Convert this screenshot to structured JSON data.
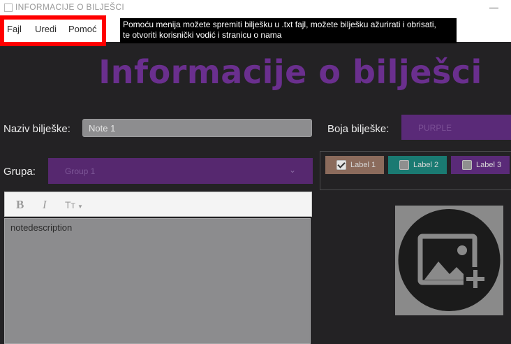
{
  "window": {
    "title": "INFORMACIJE O BILJEŠCI",
    "minimize_glyph": "—"
  },
  "menu": {
    "items": [
      "Fajl",
      "Uredi",
      "Pomoć"
    ]
  },
  "tooltip": {
    "line1": "Pomoću menija možete spremiti bilješku u .txt fajl, možete bilješku ažurirati i obrisati,",
    "line2": "te otvoriti korisnički vodić i stranicu o nama"
  },
  "heading": "Informacije o bilješci",
  "form": {
    "name_label": "Naziv bilješke:",
    "name_value": "Note 1",
    "color_label": "Boja bilješke:",
    "color_value": "PURPLE",
    "group_label": "Grupa:",
    "group_value": "Group 1"
  },
  "labels": [
    {
      "text": "Label 1",
      "checked": true,
      "color": "#8b6b5c"
    },
    {
      "text": "Label 2",
      "checked": false,
      "color": "#1a7a72"
    },
    {
      "text": "Label 3",
      "checked": false,
      "color": "#5a2a78"
    }
  ],
  "editor": {
    "bold_glyph": "B",
    "italic_glyph": "I",
    "fontsize_glyph": "Tт",
    "content": "notedescription"
  },
  "colors": {
    "background": "#232224",
    "accent_purple": "#6a2f8e",
    "highlight_red": "#ff0000"
  },
  "icons": [
    "add-image-icon",
    "chevron-down-icon",
    "checkbox-icon"
  ]
}
